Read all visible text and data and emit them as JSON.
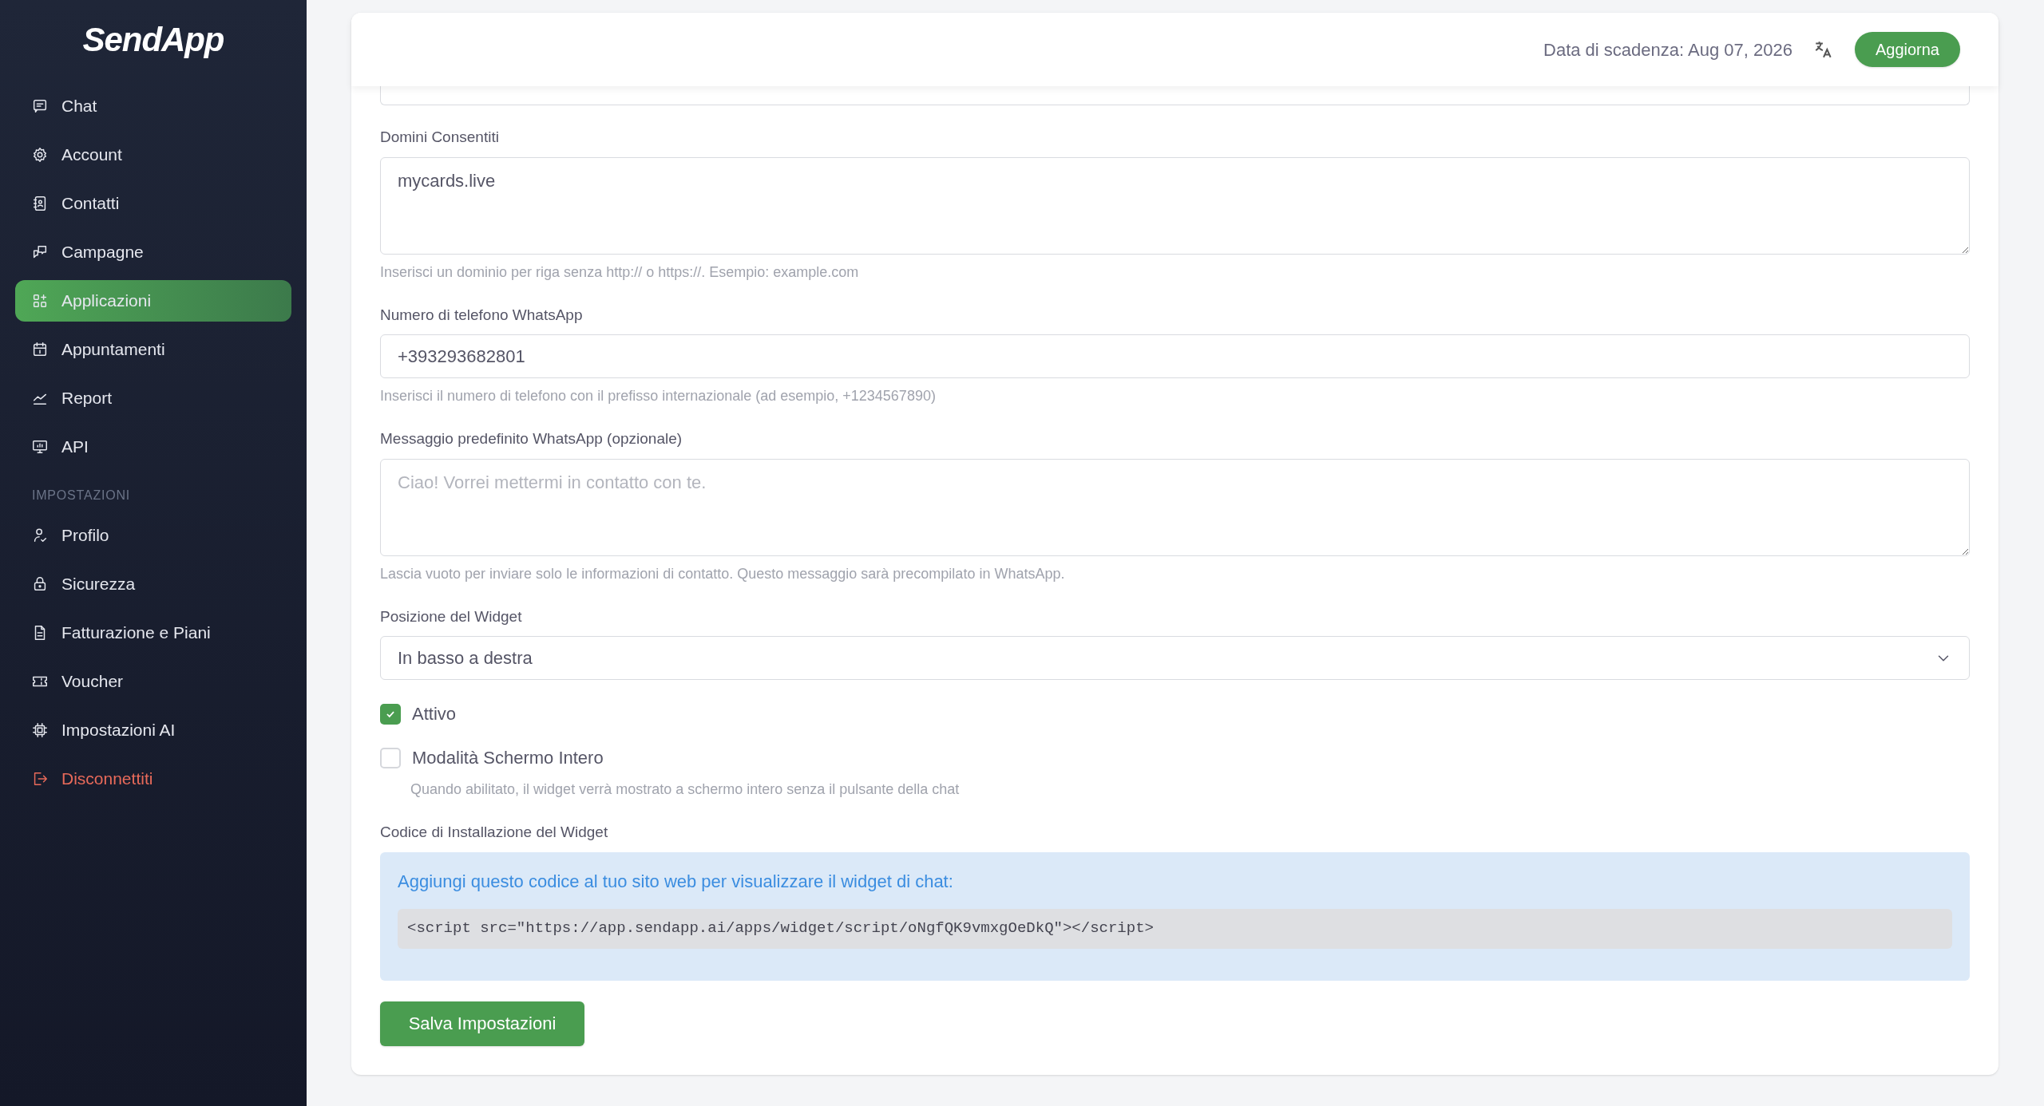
{
  "sidebar": {
    "logo": "SendApp",
    "sections": [
      {
        "items": [
          {
            "label": "Chat",
            "kind": "link",
            "selected": false
          },
          {
            "label": "Account",
            "kind": "link",
            "selected": false
          },
          {
            "label": "Contatti",
            "kind": "link",
            "selected": false
          },
          {
            "label": "Campagne",
            "kind": "link",
            "selected": false
          },
          {
            "label": "Applicazioni",
            "kind": "link",
            "selected": true
          },
          {
            "label": "Appuntamenti",
            "kind": "link",
            "selected": false
          },
          {
            "label": "Report",
            "kind": "link",
            "selected": false
          },
          {
            "label": "API",
            "kind": "link",
            "selected": false
          }
        ]
      },
      {
        "heading": "IMPOSTAZIONI",
        "items": [
          {
            "label": "Profilo",
            "kind": "link",
            "selected": false
          },
          {
            "label": "Sicurezza",
            "kind": "link",
            "selected": false
          },
          {
            "label": "Fatturazione e Piani",
            "kind": "link",
            "selected": false
          },
          {
            "label": "Voucher",
            "kind": "link",
            "selected": false
          },
          {
            "label": "Impostazioni AI",
            "kind": "link",
            "selected": false
          },
          {
            "label": "Disconnettiti",
            "kind": "logout",
            "selected": false
          }
        ]
      }
    ]
  },
  "header": {
    "expiry": "Data di scadenza: Aug 07, 2026",
    "button": "Aggiorna"
  },
  "form": {
    "fields": [
      {
        "kind": "textarea",
        "label": "Domini Consentiti",
        "value": "mycards.live",
        "hint": "Inserisci un dominio per riga senza http:// o https://. Esempio: example.com"
      },
      {
        "kind": "input",
        "label": "Numero di telefono WhatsApp",
        "value": "+393293682801",
        "hint": "Inserisci il numero di telefono con il prefisso internazionale (ad esempio, +1234567890)"
      },
      {
        "kind": "textarea",
        "label": "Messaggio predefinito WhatsApp (opzionale)",
        "placeholder": "Ciao! Vorrei mettermi in contatto con te.",
        "hint": "Lascia vuoto per inviare solo le informazioni di contatto. Questo messaggio sarà precompilato in WhatsApp."
      },
      {
        "kind": "select",
        "label": "Posizione del Widget",
        "value": "In basso a destra"
      },
      {
        "kind": "checkbox",
        "label": "Attivo",
        "checked": true
      },
      {
        "kind": "checkbox",
        "label": "Modalità Schermo Intero",
        "checked": false,
        "hint": "Quando abilitato, il widget verrà mostrato a schermo intero senza il pulsante della chat"
      },
      {
        "kind": "code",
        "label": "Codice di Installazione del Widget",
        "intro": "Aggiungi questo codice al tuo sito web per visualizzare il widget di chat:",
        "code": "<script src=\"https://app.sendapp.ai/apps/widget/script/oNgfQK9vmxgOeDkQ\"></script>"
      }
    ],
    "submit": "Salva Impostazioni"
  }
}
